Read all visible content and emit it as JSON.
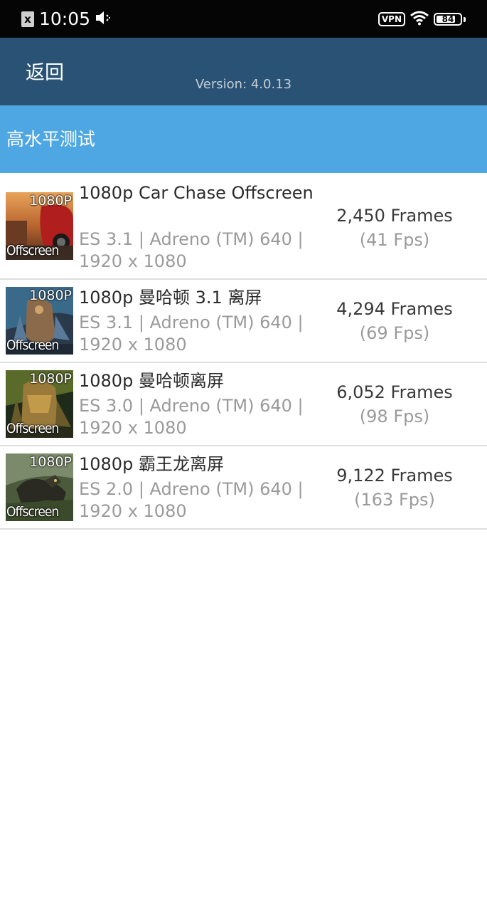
{
  "status_bar": {
    "time": "10:05",
    "sim_label": "x",
    "vpn_label": "VPN",
    "battery": "84",
    "battery_level": 0.84
  },
  "header": {
    "back_label": "返回",
    "version": "Version: 4.0.13"
  },
  "section": {
    "title": "高水平测试"
  },
  "tests": [
    {
      "thumb_badge": "1080P",
      "thumb_label": "Offscreen",
      "title": "1080p Car Chase Offscreen",
      "meta": "ES 3.1 | Adreno (TM) 640 | 1920 x 1080",
      "frames": "2,450 Frames",
      "fps": "(41 Fps)"
    },
    {
      "thumb_badge": "1080P",
      "thumb_label": "Offscreen",
      "title": "1080p 曼哈顿 3.1 离屏",
      "meta": "ES 3.1 | Adreno (TM) 640 | 1920 x 1080",
      "frames": "4,294 Frames",
      "fps": "(69 Fps)"
    },
    {
      "thumb_badge": "1080P",
      "thumb_label": "Offscreen",
      "title": "1080p 曼哈顿离屏",
      "meta": "ES 3.0 | Adreno (TM) 640 | 1920 x 1080",
      "frames": "6,052 Frames",
      "fps": "(98 Fps)"
    },
    {
      "thumb_badge": "1080P",
      "thumb_label": "Offscreen",
      "title": "1080p 霸王龙离屏",
      "meta": "ES 2.0 | Adreno (TM) 640 | 1920 x 1080",
      "frames": "9,122 Frames",
      "fps": "(163 Fps)"
    }
  ],
  "colors": {
    "header_bg": "#2a5274",
    "section_bg": "#4ea6e2",
    "status_bg": "#050505"
  }
}
